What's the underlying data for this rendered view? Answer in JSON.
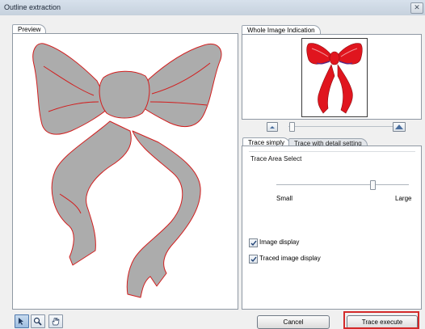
{
  "window": {
    "title": "Outline extraction",
    "close_symbol": "✕"
  },
  "preview": {
    "tab_label": "Preview"
  },
  "whole_image": {
    "tab_label": "Whole Image Indication"
  },
  "zoom": {
    "level_fraction": 0.02
  },
  "trace_tabs": [
    {
      "label": "Trace simply",
      "active": true
    },
    {
      "label": "Trace with detail setting",
      "active": false
    }
  ],
  "trace_area": {
    "group_label": "Trace Area Select",
    "min_label": "Small",
    "max_label": "Large",
    "value_fraction": 0.72
  },
  "options": {
    "image_display": {
      "label": "Image display",
      "checked": true
    },
    "traced_image_display": {
      "label": "Traced image display",
      "checked": true
    }
  },
  "buttons": {
    "cancel": "Cancel",
    "trace_execute": "Trace execute"
  },
  "tools": [
    {
      "icon": "arrow-pointer-icon",
      "active": true
    },
    {
      "icon": "magnifier-icon",
      "active": false
    },
    {
      "icon": "hand-icon",
      "active": false
    }
  ],
  "colors": {
    "outline": "#d21e1e",
    "fill": "#acacac",
    "bow_red": "#e0151e",
    "highlight": "#d42a2a"
  }
}
